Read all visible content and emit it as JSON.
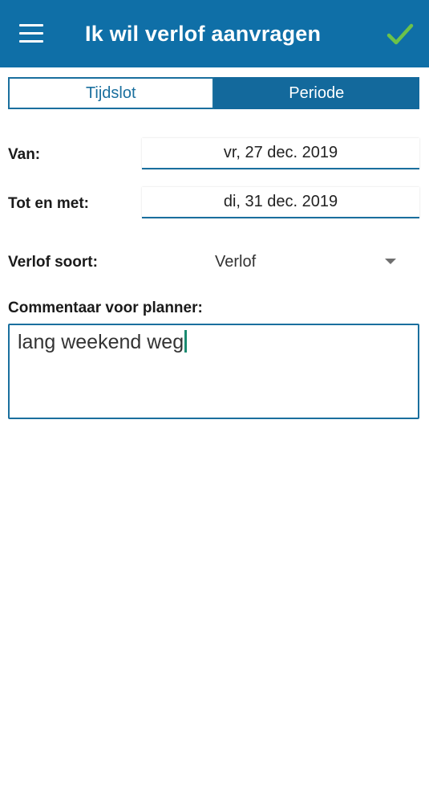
{
  "header": {
    "title": "Ik wil verlof aanvragen",
    "bar_color": "#0f6fa7",
    "confirm_color": "#6cc24a"
  },
  "segmented": {
    "tabs": [
      {
        "label": "Tijdslot",
        "selected": false
      },
      {
        "label": "Periode",
        "selected": true
      }
    ]
  },
  "form": {
    "from_label": "Van:",
    "from_value": "vr, 27 dec. 2019",
    "to_label": "Tot en met:",
    "to_value": "di, 31 dec. 2019",
    "leave_type_label": "Verlof soort:",
    "leave_type_value": "Verlof",
    "comment_label": "Commentaar voor planner:",
    "comment_value": "lang weekend weg"
  },
  "icons": {
    "menu": "hamburger-menu-icon",
    "confirm": "checkmark-icon",
    "dropdown": "dropdown-arrow-icon"
  }
}
